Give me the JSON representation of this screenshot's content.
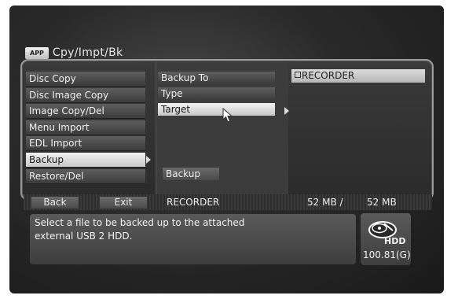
{
  "header": {
    "app_badge": "APP",
    "title": "Cpy/Impt/Bk"
  },
  "left_menu": {
    "items": [
      {
        "label": "Disc Copy"
      },
      {
        "label": "Disc Image Copy"
      },
      {
        "label": "Image Copy/Del"
      },
      {
        "label": "Menu Import"
      },
      {
        "label": "EDL Import"
      },
      {
        "label": "Backup"
      },
      {
        "label": "Restore/Del"
      }
    ],
    "selected_index": 5
  },
  "mid_menu": {
    "items": [
      {
        "label": "Backup To"
      },
      {
        "label": "Type"
      },
      {
        "label": "Target"
      }
    ],
    "selected_index": 2,
    "action_label": "Backup"
  },
  "value": {
    "backup_to": "RECORDER"
  },
  "status_bar": {
    "back_label": "Back",
    "exit_label": "Exit",
    "device": "RECORDER",
    "used": "52 MB /",
    "total": "52 MB"
  },
  "message": {
    "line1": "Select a file to be backed up to the attached",
    "line2": "external USB 2 HDD."
  },
  "hdd": {
    "label": "HDD",
    "size": "100.81(G)"
  },
  "colors": {
    "selected_bg": "#e6e6e6",
    "menu_bg": "#4a4a4a",
    "screen_bg": "#2a2a2a"
  }
}
